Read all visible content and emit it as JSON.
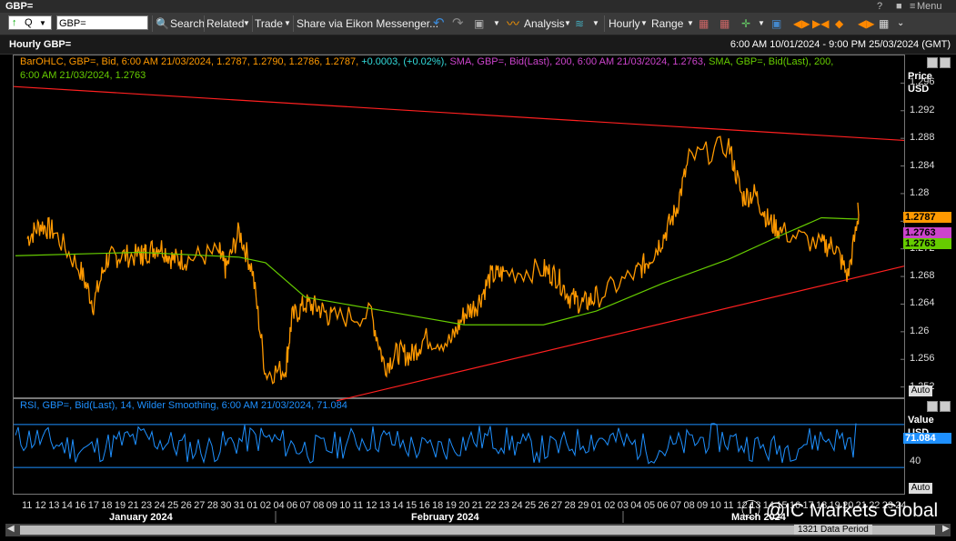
{
  "window": {
    "title": "GBP=",
    "controls": {
      "help": "?",
      "pin": "■",
      "menu_label": "Menu"
    }
  },
  "toolbar": {
    "ric": "GBP=",
    "search_label": "Search",
    "related_label": "Related",
    "trade_label": "Trade",
    "share_label": "Share via Eikon Messenger...",
    "analysis_label": "Analysis",
    "interval_label": "Hourly",
    "range_label": "Range"
  },
  "chart_header": {
    "title": "Hourly GBP=",
    "date_range": "6:00 AM 10/01/2024 - 9:00 PM 25/03/2024 (GMT)"
  },
  "price_legend": {
    "line1_orange": "BarOHLC, GBP=, Bid, 6:00 AM 21/03/2024, 1.2787, 1.2790, 1.2786, 1.2787,",
    "line1_change": "+0.0003, (+0.02%),",
    "line1_sma1": "SMA, GBP=, Bid(Last),  200,  6:00 AM 21/03/2024, 1.2763,",
    "line1_sma2": "SMA, GBP=, Bid(Last),  200,",
    "line2_sma2": "6:00 AM 21/03/2024, 1.2763"
  },
  "rsi_legend": "RSI, GBP=, Bid(Last),  14, Wilder Smoothing, 6:00 AM 21/03/2024, 71.084",
  "price_axis": {
    "title_line1": "Price",
    "title_line2": "USD",
    "ticks": [
      "1.296",
      "1.292",
      "1.288",
      "1.284",
      "1.28",
      "1.276",
      "1.272",
      "1.268",
      "1.264",
      "1.26",
      "1.256",
      "1.252"
    ],
    "last_price_tag": "1.2787",
    "sma_tag_1": "1.2763",
    "sma_tag_2": "1.2763",
    "auto_label": "Auto"
  },
  "rsi_axis": {
    "title_line1": "Value",
    "title_line2": "USD",
    "tick_40": "40",
    "rsi_tag": "71.084",
    "auto_label": "Auto"
  },
  "x_axis": {
    "days": [
      "11",
      "12",
      "13",
      "14",
      "16",
      "17",
      "18",
      "19",
      "21",
      "23",
      "24",
      "25",
      "26",
      "27",
      "28",
      "30",
      "31",
      "01",
      "02",
      "04",
      "06",
      "07",
      "08",
      "09",
      "10",
      "11",
      "12",
      "13",
      "14",
      "15",
      "16",
      "18",
      "19",
      "20",
      "21",
      "22",
      "23",
      "24",
      "25",
      "26",
      "27",
      "28",
      "29",
      "01",
      "02",
      "03",
      "04",
      "05",
      "06",
      "07",
      "08",
      "09",
      "10",
      "11",
      "12",
      "13",
      "14",
      "15",
      "16",
      "17",
      "18",
      "19",
      "20",
      "21",
      "22",
      "23",
      "24"
    ],
    "months": [
      "January 2024",
      "February 2024",
      "March 2024"
    ]
  },
  "scroll": {
    "period_label": "1321 Data Period"
  },
  "watermark": "@IC Markets Global",
  "colors": {
    "price": "#ff9900",
    "sma_magenta": "#cc44cc",
    "sma_green": "#66cc00",
    "trendline": "#ff2020",
    "rsi": "#1e90ff",
    "change_cyan": "#33dddd"
  },
  "chart_data": {
    "type": "line",
    "title": "Hourly GBP=",
    "ylabel": "Price USD",
    "ylim": [
      1.2505,
      1.3
    ],
    "x_range": [
      "10/01/2024",
      "25/03/2024"
    ],
    "series": [
      {
        "name": "BarOHLC, GBP=, Bid",
        "x": [
          "11/01",
          "12/01",
          "13/01",
          "16/01",
          "17/01",
          "18/01",
          "19/01",
          "22/01",
          "23/01",
          "24/01",
          "25/01",
          "26/01",
          "29/01",
          "30/01",
          "31/01",
          "01/02",
          "02/02",
          "05/02",
          "06/02",
          "07/02",
          "08/02",
          "09/02",
          "12/02",
          "13/02",
          "14/02",
          "15/02",
          "16/02",
          "19/02",
          "20/02",
          "21/02",
          "22/02",
          "23/02",
          "26/02",
          "27/02",
          "28/02",
          "29/02",
          "01/03",
          "04/03",
          "05/03",
          "06/03",
          "07/03",
          "08/03",
          "11/03",
          "12/03",
          "13/03",
          "14/03",
          "15/03",
          "18/03",
          "19/03",
          "20/03",
          "21/03"
        ],
        "values": [
          1.2735,
          1.2755,
          1.2745,
          1.269,
          1.264,
          1.2705,
          1.271,
          1.271,
          1.2715,
          1.2725,
          1.2705,
          1.2705,
          1.2715,
          1.269,
          1.2745,
          1.269,
          1.254,
          1.2545,
          1.262,
          1.264,
          1.2635,
          1.262,
          1.2625,
          1.255,
          1.257,
          1.2565,
          1.259,
          1.2585,
          1.2625,
          1.264,
          1.268,
          1.2685,
          1.269,
          1.268,
          1.265,
          1.264,
          1.265,
          1.2685,
          1.2705,
          1.2735,
          1.2775,
          1.285,
          1.287,
          1.2795,
          1.28,
          1.276,
          1.2745,
          1.2725,
          1.2725,
          1.268,
          1.2787
        ]
      },
      {
        "name": "SMA 200",
        "x": [
          "11/01",
          "22/01",
          "31/01",
          "02/02",
          "07/02",
          "13/02",
          "20/02",
          "26/02",
          "01/03",
          "06/03",
          "11/03",
          "15/03",
          "18/03",
          "21/03"
        ],
        "values": [
          1.271,
          1.2715,
          1.2708,
          1.27,
          1.265,
          1.263,
          1.261,
          1.261,
          1.263,
          1.267,
          1.2705,
          1.274,
          1.2765,
          1.2763
        ]
      }
    ],
    "trendlines": [
      {
        "name": "upper",
        "from": [
          "10/01",
          1.2955
        ],
        "to": [
          "25/03",
          1.2877
        ]
      },
      {
        "name": "lower",
        "from": [
          "06/02",
          1.25
        ],
        "to": [
          "25/03",
          1.2695
        ]
      }
    ],
    "rsi": {
      "name": "RSI 14 Wilder",
      "last": 71.084,
      "levels": [
        70,
        30
      ]
    }
  }
}
